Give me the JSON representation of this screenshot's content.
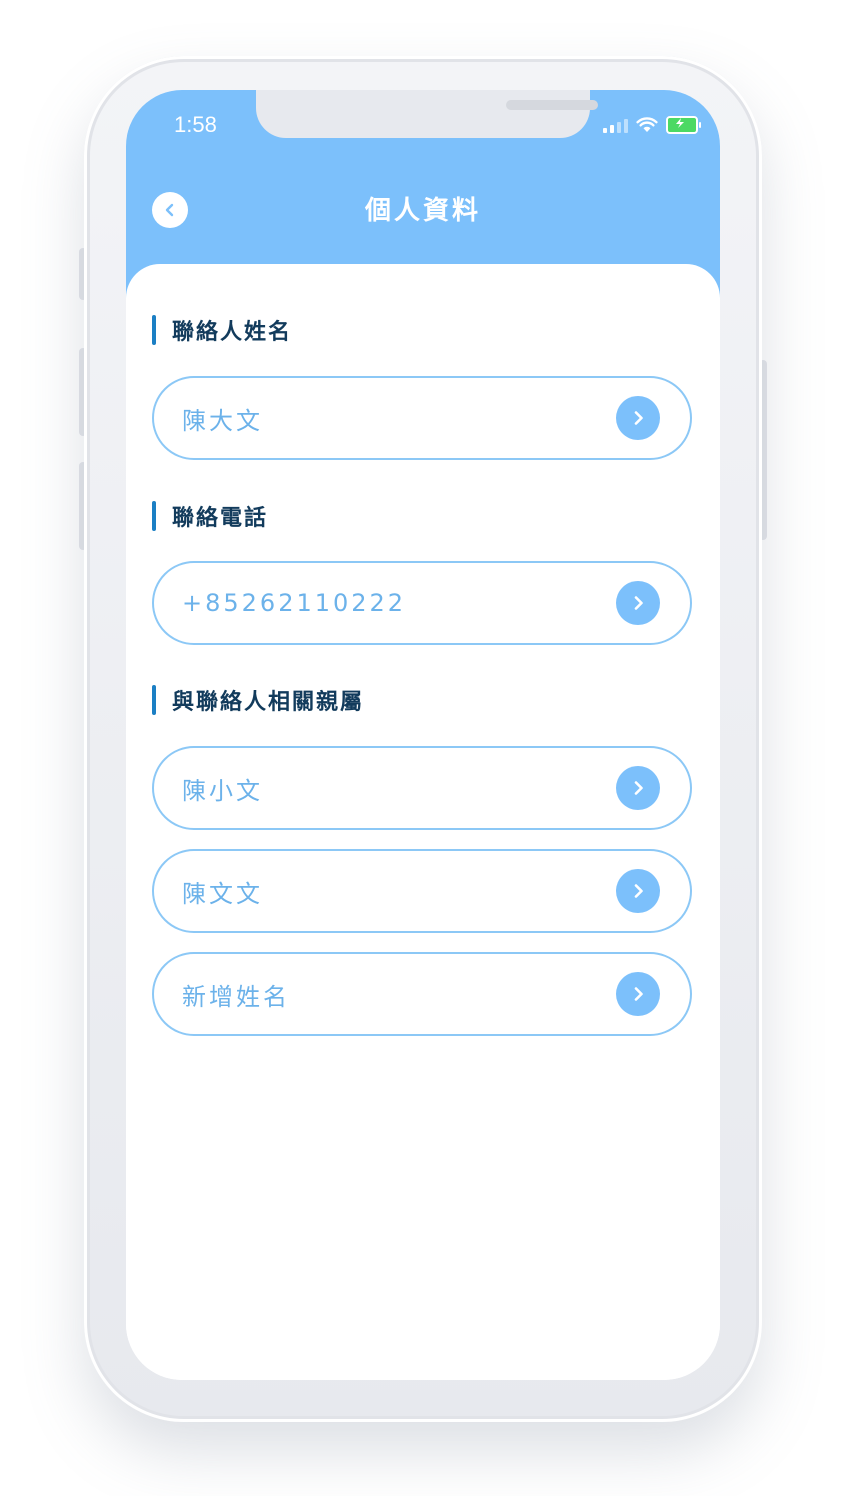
{
  "status_bar": {
    "time": "1:58"
  },
  "header": {
    "title": "個人資料",
    "back_icon": "chevron-left-icon"
  },
  "sections": [
    {
      "label": "聯絡人姓名",
      "fields": [
        {
          "value": "陳大文",
          "icon": "chevron-right-icon"
        }
      ]
    },
    {
      "label": "聯絡電話",
      "fields": [
        {
          "value": "+85262110222",
          "icon": "chevron-right-icon"
        }
      ]
    },
    {
      "label": "與聯絡人相關親屬",
      "fields": [
        {
          "value": "陳小文",
          "icon": "chevron-right-icon"
        },
        {
          "value": "陳文文",
          "icon": "chevron-right-icon"
        },
        {
          "value": "新增姓名",
          "icon": "chevron-right-icon"
        }
      ]
    }
  ],
  "colors": {
    "header": "#7cc0fb",
    "accent": "#1b7fc4",
    "field_border": "#8cc8f6",
    "field_text": "#6cb2ea",
    "label_text": "#123b5c"
  }
}
